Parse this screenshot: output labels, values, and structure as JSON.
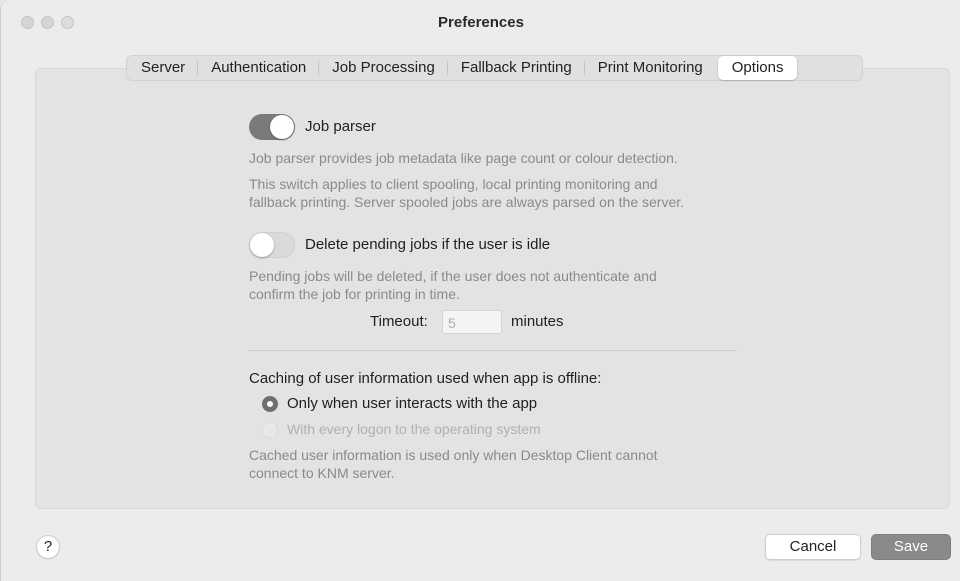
{
  "window": {
    "title": "Preferences"
  },
  "tabs": [
    {
      "label": "Server"
    },
    {
      "label": "Authentication"
    },
    {
      "label": "Job Processing"
    },
    {
      "label": "Fallback Printing"
    },
    {
      "label": "Print Monitoring"
    },
    {
      "label": "Options",
      "selected": true
    }
  ],
  "job_parser": {
    "label": "Job parser",
    "enabled": true,
    "desc1": "Job parser provides job metadata like page count or colour detection.",
    "desc2_line1": "This switch applies to client spooling, local printing monitoring and",
    "desc2_line2": "fallback printing. Server spooled jobs are always parsed on the server."
  },
  "delete_pending": {
    "label": "Delete pending jobs if the user is idle",
    "enabled": false,
    "desc_line1": "Pending jobs will be deleted, if the user does not authenticate and",
    "desc_line2": "confirm the job for printing in time.",
    "timeout_label": "Timeout:",
    "timeout_value": "5",
    "timeout_unit": "minutes"
  },
  "caching": {
    "heading": "Caching of user information used when app is offline:",
    "options": [
      {
        "label": "Only when user interacts with the app",
        "selected": true,
        "disabled": false
      },
      {
        "label": "With every logon to the operating system",
        "selected": false,
        "disabled": true
      }
    ],
    "desc_line1": "Cached user information is used only when Desktop Client cannot",
    "desc_line2": "connect to KNM server."
  },
  "footer": {
    "help_label": "?",
    "cancel_label": "Cancel",
    "save_label": "Save"
  },
  "icons": {
    "help": "question-mark-icon"
  },
  "colors": {
    "toggle_on": "#7a7a7a",
    "save_button": "#8a8a8a",
    "secondary_text": "#8a8a8a"
  }
}
